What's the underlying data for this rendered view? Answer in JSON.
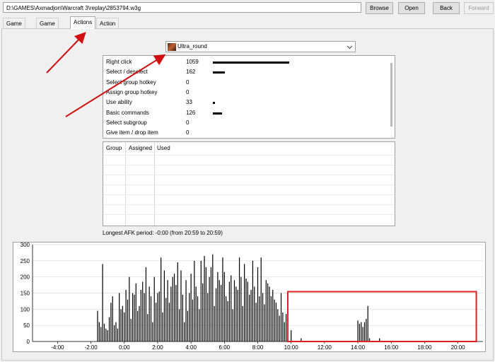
{
  "toolbar": {
    "path_value": "D:\\GAMES\\Axmadjon\\Warcraft 3\\replay\\2853794.w3g",
    "browse_label": "Browse",
    "open_label": "Open",
    "back_label": "Back",
    "forward_label": "Forward"
  },
  "tabs": [
    {
      "label": "Game Info"
    },
    {
      "label": "Game Chat"
    },
    {
      "label": "Actions"
    },
    {
      "label": "Action Log"
    }
  ],
  "player": {
    "name": "Ultra_round",
    "icon": "hero-portrait-icon"
  },
  "actions": [
    {
      "name": "Right click",
      "count": "1059",
      "value": 1059
    },
    {
      "name": "Select / deselect",
      "count": "162",
      "value": 162
    },
    {
      "name": "Select group hotkey",
      "count": "0",
      "value": 0
    },
    {
      "name": "Assign group hotkey",
      "count": "0",
      "value": 0
    },
    {
      "name": "Use ability",
      "count": "33",
      "value": 33
    },
    {
      "name": "Basic commands",
      "count": "126",
      "value": 126
    },
    {
      "name": "Select subgroup",
      "count": "0",
      "value": 0
    },
    {
      "name": "Give item / drop item",
      "count": "0",
      "value": 0
    }
  ],
  "groups_table": {
    "col_group": "Group",
    "col_assigned": "Assigned",
    "col_used": "Used"
  },
  "afk_text": "Longest AFK period: -0:00 (from 20:59 to 20:59)",
  "chart_data": {
    "type": "bar",
    "xlabel": "",
    "ylabel": "",
    "xlim": [
      -5.5,
      21.5
    ],
    "ylim": [
      0,
      300
    ],
    "grid": true,
    "y_ticks": [
      "0",
      "50",
      "100",
      "150",
      "200",
      "250",
      "300"
    ],
    "x_ticks": [
      "-4:00",
      "-2:00",
      "0:00",
      "2:00",
      "4:00",
      "6:00",
      "8:00",
      "10:00",
      "12:00",
      "14:00",
      "16:00",
      "18:00",
      "20:00"
    ],
    "x_tick_values": [
      -4,
      -2,
      0,
      2,
      4,
      6,
      8,
      10,
      12,
      14,
      16,
      18,
      20
    ],
    "bar_color": "#000000",
    "highlight_color": "#e02020",
    "highlight_range": [
      9.8,
      21.1
    ],
    "values_note": "",
    "x": [
      -1.6,
      -1.5,
      -1.4,
      -1.3,
      -1.2,
      -1.1,
      -1.0,
      -0.9,
      -0.8,
      -0.7,
      -0.6,
      -0.5,
      -0.4,
      -0.3,
      -0.2,
      -0.1,
      0.0,
      0.1,
      0.2,
      0.3,
      0.4,
      0.5,
      0.6,
      0.7,
      0.8,
      0.9,
      1.0,
      1.1,
      1.2,
      1.3,
      1.4,
      1.5,
      1.6,
      1.7,
      1.8,
      1.9,
      2.0,
      2.1,
      2.2,
      2.3,
      2.4,
      2.5,
      2.6,
      2.7,
      2.8,
      2.9,
      3.0,
      3.1,
      3.2,
      3.3,
      3.4,
      3.5,
      3.6,
      3.7,
      3.8,
      3.9,
      4.0,
      4.1,
      4.2,
      4.3,
      4.4,
      4.5,
      4.6,
      4.7,
      4.8,
      4.9,
      5.0,
      5.1,
      5.2,
      5.3,
      5.4,
      5.5,
      5.6,
      5.7,
      5.8,
      5.9,
      6.0,
      6.1,
      6.2,
      6.3,
      6.4,
      6.5,
      6.6,
      6.7,
      6.8,
      6.9,
      7.0,
      7.1,
      7.2,
      7.3,
      7.4,
      7.5,
      7.6,
      7.7,
      7.8,
      7.9,
      8.0,
      8.1,
      8.2,
      8.3,
      8.4,
      8.5,
      8.6,
      8.7,
      8.8,
      8.9,
      9.0,
      9.1,
      9.2,
      9.3,
      9.4,
      9.5,
      9.6,
      9.7,
      9.8,
      10.0,
      10.6,
      14.0,
      14.1,
      14.2,
      14.3,
      14.4,
      14.5,
      14.6,
      14.7,
      15.3,
      16.4
    ],
    "y": [
      95,
      60,
      45,
      240,
      55,
      40,
      35,
      75,
      120,
      140,
      50,
      60,
      40,
      150,
      100,
      110,
      90,
      160,
      130,
      200,
      70,
      150,
      145,
      180,
      95,
      110,
      160,
      185,
      150,
      230,
      85,
      170,
      140,
      60,
      200,
      120,
      150,
      155,
      260,
      90,
      220,
      135,
      190,
      120,
      170,
      200,
      210,
      175,
      245,
      100,
      220,
      145,
      60,
      190,
      95,
      150,
      210,
      130,
      250,
      170,
      140,
      100,
      250,
      180,
      265,
      230,
      150,
      200,
      230,
      270,
      110,
      165,
      215,
      190,
      175,
      260,
      215,
      140,
      125,
      185,
      205,
      100,
      190,
      170,
      160,
      260,
      200,
      110,
      240,
      195,
      185,
      145,
      160,
      250,
      170,
      120,
      230,
      140,
      260,
      150,
      115,
      190,
      180,
      170,
      140,
      160,
      130,
      120,
      100,
      80,
      150,
      90,
      60,
      85,
      45,
      35,
      10,
      65,
      55,
      60,
      45,
      60,
      70,
      110,
      10,
      10
    ]
  }
}
